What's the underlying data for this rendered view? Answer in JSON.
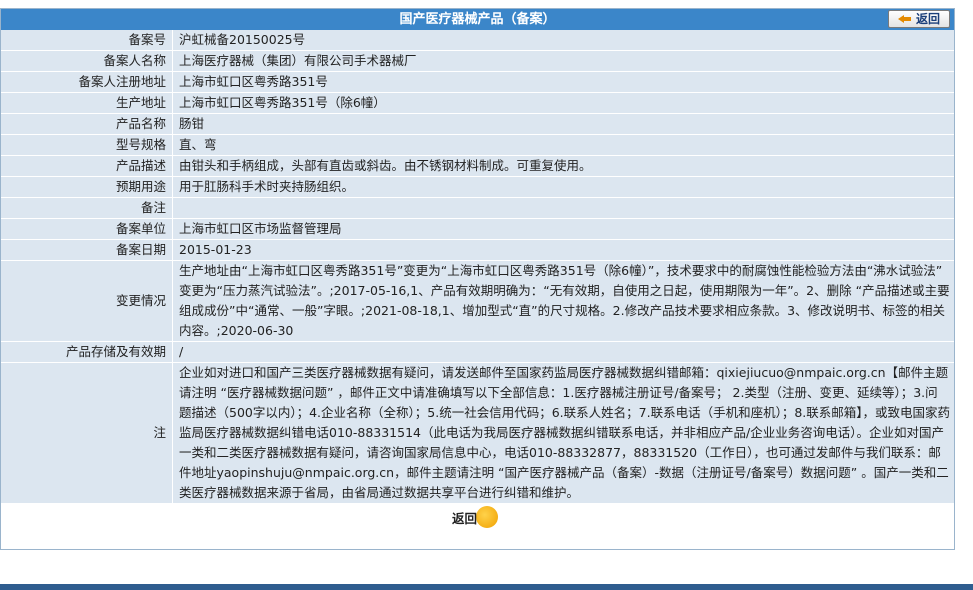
{
  "header": {
    "title": "国产医疗器械产品（备案）",
    "back_label": "返回"
  },
  "rows": [
    {
      "label": "备案号",
      "value": "沪虹械备20150025号"
    },
    {
      "label": "备案人名称",
      "value": "上海医疗器械（集团）有限公司手术器械厂"
    },
    {
      "label": "备案人注册地址",
      "value": "上海市虹口区粤秀路351号"
    },
    {
      "label": "生产地址",
      "value": "上海市虹口区粤秀路351号（除6幢）"
    },
    {
      "label": "产品名称",
      "value": "肠钳"
    },
    {
      "label": "型号规格",
      "value": "直、弯"
    },
    {
      "label": "产品描述",
      "value": "由钳头和手柄组成，头部有直齿或斜齿。由不锈钢材料制成。可重复使用。"
    },
    {
      "label": "预期用途",
      "value": "用于肛肠科手术时夹持肠组织。"
    },
    {
      "label": "备注",
      "value": ""
    },
    {
      "label": "备案单位",
      "value": "上海市虹口区市场监督管理局"
    },
    {
      "label": "备案日期",
      "value": "2015-01-23"
    },
    {
      "label": "变更情况",
      "value": "生产地址由“上海市虹口区粤秀路351号”变更为“上海市虹口区粤秀路351号（除6幢）”，技术要求中的耐腐蚀性能检验方法由“沸水试验法” 变更为“压力蒸汽试验法”。;2017-05-16,1、产品有效期明确为：“无有效期，自使用之日起，使用期限为一年”。2、删除 “产品描述或主要组成成份”中“通常、一般”字眼。;2021-08-18,1、增加型式“直”的尺寸规格。2.修改产品技术要求相应条款。3、修改说明书、标签的相关内容。;2020-06-30"
    },
    {
      "label": "产品存储及有效期",
      "value": "/"
    },
    {
      "label": "注",
      "value": "企业如对进口和国产三类医疗器械数据有疑问，请发送邮件至国家药监局医疗器械数据纠错邮箱：qixiejiucuo@nmpaic.org.cn【邮件主题请注明 “医疗器械数据问题” ，邮件正文中请准确填写以下全部信息：1.医疗器械注册证号/备案号； 2.类型（注册、变更、延续等）；3.问题描述（500字以内）；4.企业名称（全称）；5.统一社会信用代码；6.联系人姓名；7.联系电话（手机和座机）；8.联系邮箱】，或致电国家药监局医疗器械数据纠错电话010-88331514（此电话为我局医疗器械数据纠错联系电话，并非相应产品/企业业务咨询电话）。企业如对国产一类和二类医疗器械数据有疑问，请咨询国家局信息中心，电话010-88332877，88331520（工作日），也可通过发邮件与我们联系：邮件地址yaopinshuju@nmpaic.org.cn，邮件主题请注明 “国产医疗器械产品（备案）-数据（注册证号/备案号）数据问题” 。国产一类和二类医疗器械数据来源于省局，由省局通过数据共享平台进行纠错和维护。"
    }
  ],
  "footer": {
    "back_label": "返回"
  },
  "colors": {
    "title_bar": "#3b86c9",
    "row_bg": "#dce6f0",
    "accent": "#f0a000"
  }
}
